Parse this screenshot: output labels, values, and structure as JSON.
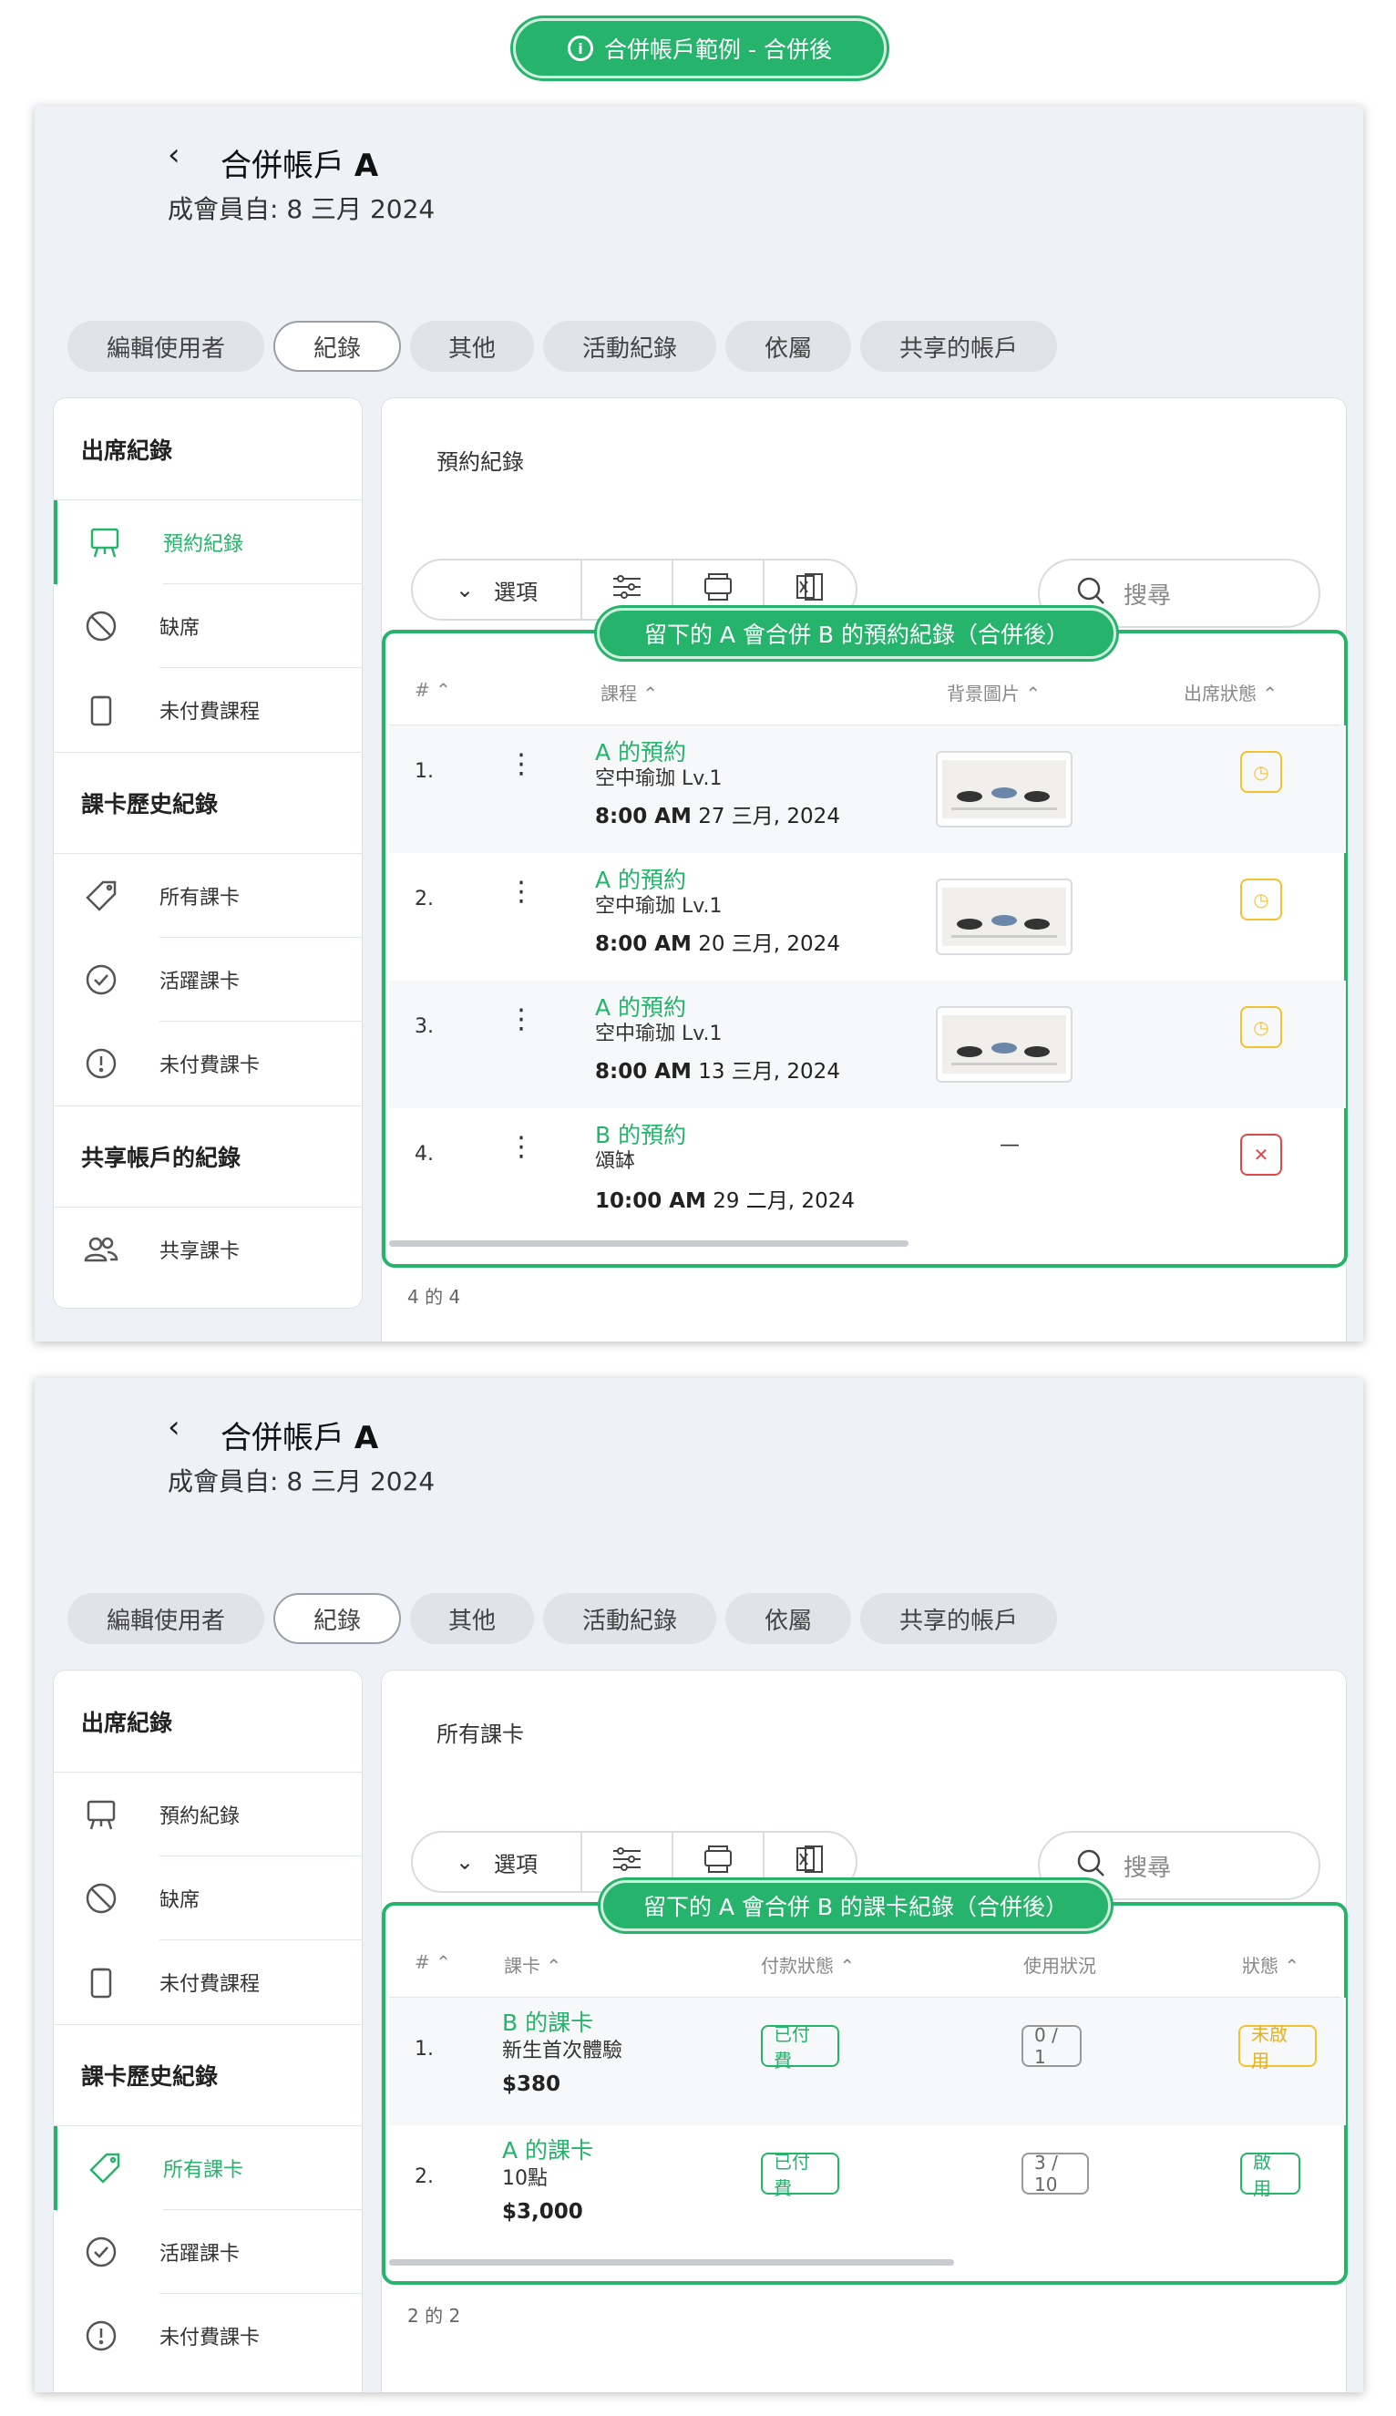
{
  "banner": {
    "title": "合併帳戶範例 - 合併後"
  },
  "panels": [
    {
      "header": {
        "title_prefix": "合併帳戶 ",
        "title_bold": "A",
        "subtitle": "成會員自: 8 三月 2024"
      },
      "tabs": [
        "編輯使用者",
        "紀錄",
        "其他",
        "活動紀錄",
        "依屬",
        "共享的帳戶"
      ],
      "active_tab": "紀錄",
      "sidebar": {
        "sections": [
          "出席紀錄",
          "課卡歷史紀錄",
          "共享帳戶的紀錄"
        ],
        "items": [
          "預約紀錄",
          "缺席",
          "未付費課程",
          "所有課卡",
          "活躍課卡",
          "未付費課卡",
          "共享課卡"
        ]
      },
      "main_title": "預約紀錄",
      "toolbar": {
        "options_label": "選項",
        "search_placeholder": "搜尋"
      },
      "highlight_label": "留下的 A 會合併 B 的預約紀錄（合併後）",
      "columns": [
        "# ⌃",
        "課程 ⌃",
        "背景圖片 ⌃",
        "出席狀態 ⌃"
      ],
      "rows": [
        {
          "num": "1.",
          "title": "A 的預約",
          "course": "空中瑜珈 Lv.1",
          "time": "8:00 AM",
          "date": " 27 三月, 2024",
          "image": "yoga-thumb",
          "status": "clock"
        },
        {
          "num": "2.",
          "title": "A 的預約",
          "course": "空中瑜珈 Lv.1",
          "time": "8:00 AM",
          "date": " 20 三月, 2024",
          "image": "yoga-thumb",
          "status": "clock"
        },
        {
          "num": "3.",
          "title": "A 的預約",
          "course": "空中瑜珈 Lv.1",
          "time": "8:00 AM",
          "date": " 13 三月, 2024",
          "image": "yoga-thumb",
          "status": "clock"
        },
        {
          "num": "4.",
          "title": "B 的預約",
          "course": "頌缽",
          "time": "10:00 AM",
          "date": " 29 二月, 2024",
          "image": "—",
          "status": "cross"
        }
      ],
      "footer": "4 的 4"
    },
    {
      "header": {
        "title_prefix": "合併帳戶 ",
        "title_bold": "A",
        "subtitle": "成會員自: 8 三月 2024"
      },
      "tabs": [
        "編輯使用者",
        "紀錄",
        "其他",
        "活動紀錄",
        "依屬",
        "共享的帳戶"
      ],
      "active_tab": "紀錄",
      "sidebar": {
        "sections": [
          "出席紀錄",
          "課卡歷史紀錄"
        ],
        "items": [
          "預約紀錄",
          "缺席",
          "未付費課程",
          "所有課卡",
          "活躍課卡",
          "未付費課卡"
        ]
      },
      "main_title": "所有課卡",
      "toolbar": {
        "options_label": "選項",
        "search_placeholder": "搜尋"
      },
      "highlight_label": "留下的 A 會合併 B 的課卡紀錄（合併後）",
      "columns": [
        "# ⌃",
        "課卡 ⌃",
        "付款狀態 ⌃",
        "使用狀況",
        "狀態 ⌃"
      ],
      "rows": [
        {
          "num": "1.",
          "title": "B 的課卡",
          "card": "新生首次體驗",
          "price": "$380",
          "payment": "已付費",
          "usage": "0 / 1",
          "status": "未啟用"
        },
        {
          "num": "2.",
          "title": "A 的課卡",
          "card": "10點",
          "price": "$3,000",
          "payment": "已付費",
          "usage": "3 / 10",
          "status": "啟用"
        }
      ],
      "footer": "2 的 2"
    }
  ],
  "colors": {
    "accent": "#26b36b",
    "warning": "#f2c230",
    "danger": "#e04848",
    "panel_bg": "#eef2f6"
  }
}
